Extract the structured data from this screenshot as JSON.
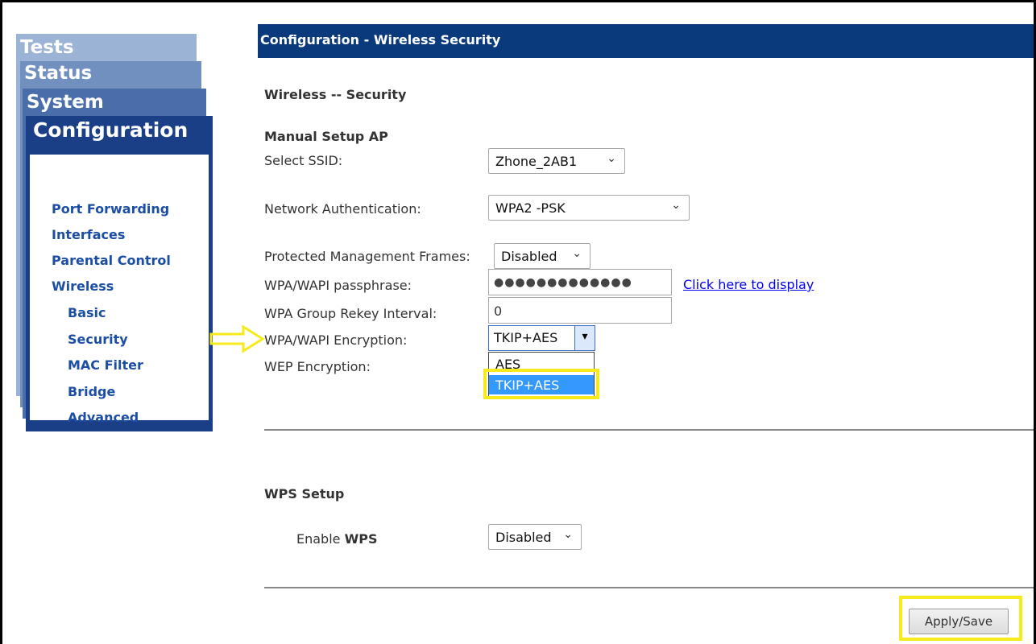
{
  "nav": {
    "tests": "Tests",
    "status": "Status",
    "system": "System",
    "configuration": "Configuration",
    "items": [
      {
        "label": "Port Forwarding"
      },
      {
        "label": "Interfaces"
      },
      {
        "label": "Parental Control"
      },
      {
        "label": "Wireless"
      },
      {
        "label": "Basic"
      },
      {
        "label": "Security"
      },
      {
        "label": "MAC Filter"
      },
      {
        "label": "Bridge"
      },
      {
        "label": "Advanced"
      }
    ]
  },
  "header": {
    "title": "Configuration - Wireless Security"
  },
  "main": {
    "section_title": "Wireless -- Security",
    "manual_setup_title": "Manual Setup AP",
    "select_ssid_label": "Select SSID:",
    "select_ssid_value": "Zhone_2AB1",
    "network_auth_label": "Network Authentication:",
    "network_auth_value": "WPA2 -PSK",
    "pmf_label": "Protected Management Frames:",
    "pmf_value": "Disabled",
    "passphrase_label": "WPA/WAPI passphrase:",
    "passphrase_value": "●●●●●●●●●●●●●",
    "display_link": "Click here to display",
    "rekey_label": "WPA Group Rekey Interval:",
    "rekey_value": "0",
    "encryption_label": "WPA/WAPI Encryption:",
    "encryption_value": "TKIP+AES",
    "encryption_options": [
      "AES",
      "TKIP+AES"
    ],
    "wep_label": "WEP Encryption:",
    "wps_title": "WPS Setup",
    "wps_enable_label_prefix": "Enable",
    "wps_enable_label_bold": "WPS",
    "wps_value": "Disabled",
    "apply_button": "Apply/Save"
  },
  "colors": {
    "header": "#0a3a7c",
    "nav_dark": "#1b3f86",
    "menu_text": "#1c4ea5",
    "highlight": "#f6ea1c",
    "option_selected": "#3399ff"
  }
}
